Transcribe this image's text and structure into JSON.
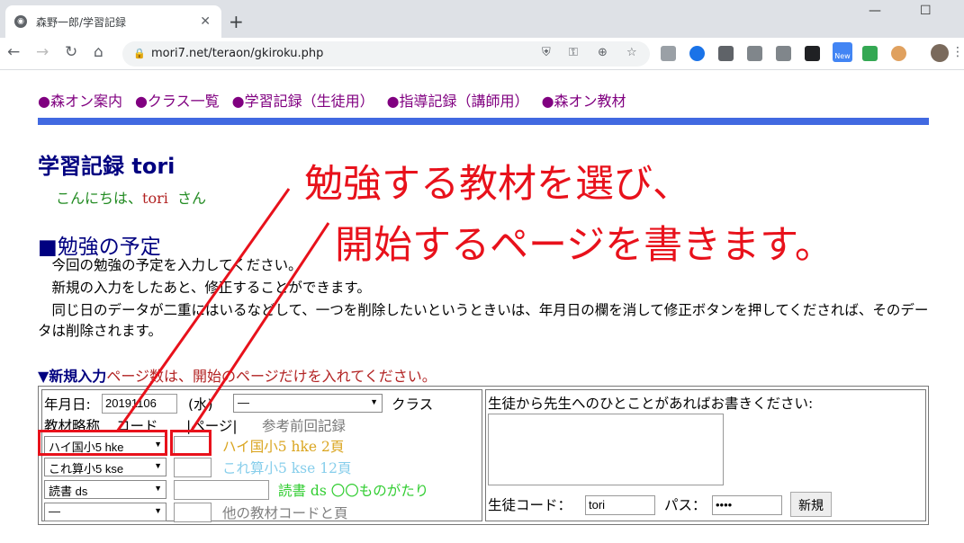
{
  "browser": {
    "tab_title": "森野一郎/学習記録",
    "url": "mori7.net/teraon/gkiroku.php",
    "new_badge": "New"
  },
  "nav": {
    "items": [
      "●森オン案内",
      "●クラス一覧",
      "●学習記録（生徒用）",
      "●指導記録（講師用）",
      "●森オン教材"
    ]
  },
  "page": {
    "title": "学習記録 tori",
    "greeting_prefix": "こんにちは、",
    "greeting_name": "tori",
    "greeting_suffix": "さん",
    "section_title": "■勉強の予定",
    "para1": "　今回の勉強の予定を入力してください。",
    "para2": "　新規の入力をしたあと、修正することができます。",
    "para3": "　同じ日のデータが二重にはいるなどして、一つを削除したいというときいは、年月日の欄を消して修正ボタンを押してくだされば、そのデータは削除されます。",
    "new_entry_label": "▼新規入力",
    "new_entry_note": "ページ数は、開始のページだけを入れてください。"
  },
  "form": {
    "date_label": "年月日:",
    "date_value": "20191106",
    "weekday": "(水)",
    "class_select": "—",
    "class_label": "クラス",
    "col_material": "教材略称",
    "col_code": "コード",
    "col_page": "|ページ|",
    "col_ref": "参考前回記録",
    "rows": [
      {
        "select": "ハイ国小5 hke",
        "page": "",
        "ref": "ハイ国小5 hke 2頁"
      },
      {
        "select": "これ算小5 kse",
        "page": "",
        "ref": "これ算小5 kse 12頁"
      },
      {
        "select": "読書 ds",
        "page": "",
        "ref": "読書 ds 〇〇ものがたり"
      },
      {
        "select": "—",
        "page": "",
        "ref": "他の教材コードと頁"
      }
    ],
    "message_label": "生徒から先生へのひとことがあればお書きください:",
    "student_code_label": "生徒コード：",
    "student_code_value": "tori",
    "pass_label": "パス：",
    "pass_value": "••••",
    "submit_label": "新規"
  },
  "annotation": {
    "line1": "勉強する教材を選び、",
    "line2": "開始するページを書きます。",
    "color": "#e8111b"
  }
}
